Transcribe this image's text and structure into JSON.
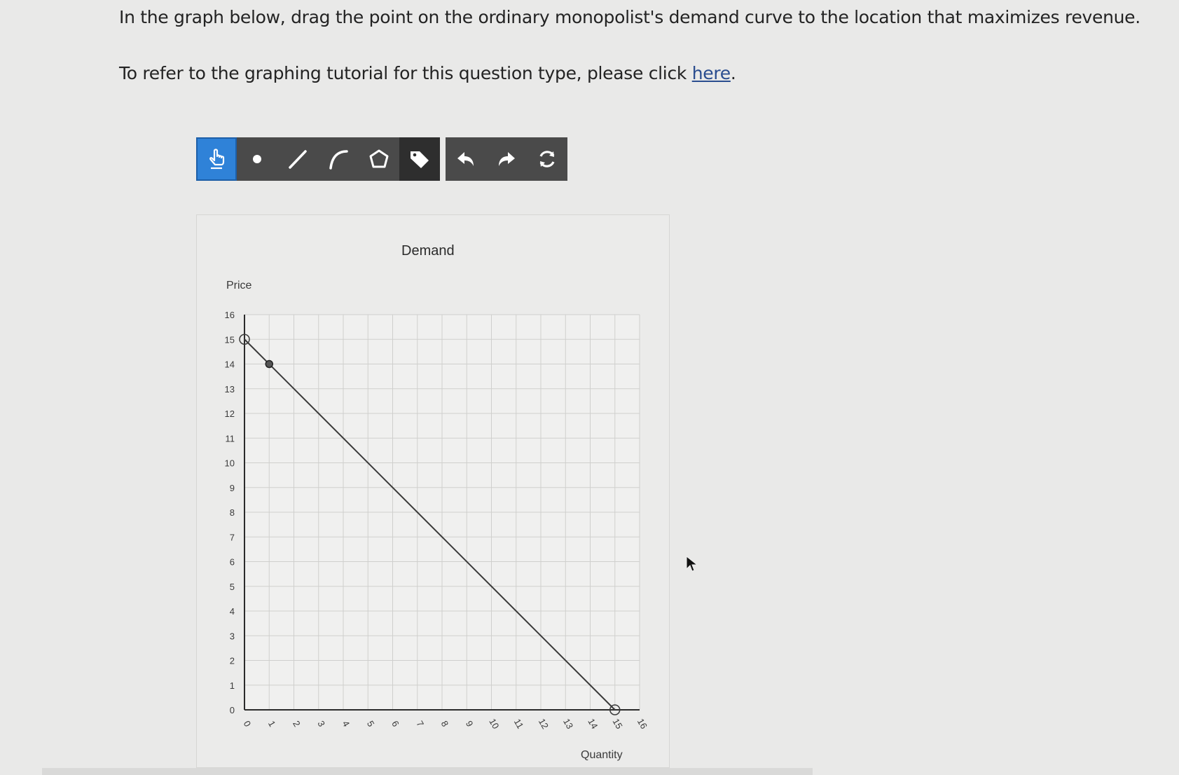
{
  "question": {
    "line1": "In the graph below, drag the point on the ordinary monopolist's demand curve to the location that maximizes revenue.",
    "line2_prefix": "To refer to the graphing tutorial for this question type, please click ",
    "link_text": "here",
    "line2_suffix": "."
  },
  "toolbar": {
    "tools": [
      {
        "icon": "drag-hand-icon",
        "active": true
      },
      {
        "icon": "point-icon"
      },
      {
        "icon": "line-icon"
      },
      {
        "icon": "curve-icon"
      },
      {
        "icon": "polygon-icon"
      },
      {
        "icon": "label-tag-icon"
      },
      {
        "icon": "undo-icon"
      },
      {
        "icon": "redo-icon"
      },
      {
        "icon": "reset-icon"
      }
    ],
    "active_color": "#2f82d8",
    "tool_color": "#4a4a4a"
  },
  "chart_data": {
    "type": "line",
    "title": "Demand",
    "xlabel": "Quantity",
    "ylabel": "Price",
    "xlim": [
      0,
      16
    ],
    "ylim": [
      0,
      16
    ],
    "x_ticks": [
      "0",
      "1",
      "2",
      "3",
      "4",
      "5",
      "6",
      "7",
      "8",
      "9",
      "10",
      "11",
      "12",
      "13",
      "14",
      "15",
      "16"
    ],
    "y_ticks": [
      "0",
      "1",
      "2",
      "3",
      "4",
      "5",
      "6",
      "7",
      "8",
      "9",
      "10",
      "11",
      "12",
      "13",
      "14",
      "15",
      "16"
    ],
    "grid": true,
    "series": [
      {
        "x": [
          0,
          15
        ],
        "y": [
          15,
          0
        ],
        "color": "#3a3a3a"
      }
    ],
    "endpoints": [
      {
        "x": 0,
        "y": 15,
        "style": "open-circle"
      },
      {
        "x": 15,
        "y": 0,
        "style": "open-circle"
      }
    ],
    "draggable_point": {
      "x": 1,
      "y": 14
    }
  }
}
